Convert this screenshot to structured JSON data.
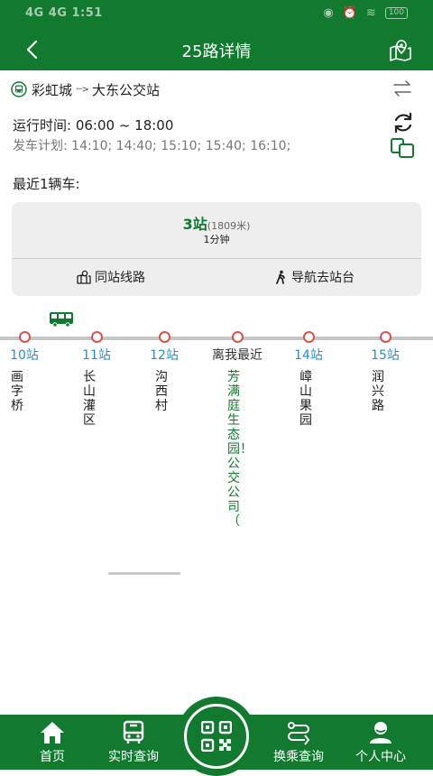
{
  "status_bar": {
    "time": "1:51",
    "network": "4G 4G",
    "battery": "100"
  },
  "header": {
    "title": "25路详情"
  },
  "route": {
    "from": "彩虹城",
    "arrow": "···>",
    "to": "大东公交站"
  },
  "schedule": {
    "operating_hours": "运行时间: 06:00 ~ 18:00",
    "departure_plan": "发车计划: 14:10; 14:40; 15:10; 15:40; 16:10;"
  },
  "recent": {
    "label": "最近1辆车:"
  },
  "bus_card": {
    "stops_away": "3站",
    "distance": "(1809米)",
    "eta": "1分钟",
    "same_station_lines": "同站线路",
    "navigate_to_stop": "导航去站台"
  },
  "stations": [
    {
      "label": "10站",
      "name": "画字桥"
    },
    {
      "label": "11站",
      "name": "长山灌区"
    },
    {
      "label": "12站",
      "name": "沟西村"
    },
    {
      "label": "离我最近",
      "name": "芳满庭生态园！公交公司（"
    },
    {
      "label": "14站",
      "name": "嶂山果园"
    },
    {
      "label": "15站",
      "name": "润兴路"
    }
  ],
  "tabs": {
    "home": "首页",
    "realtime": "实时查询",
    "transfer": "换乘查询",
    "profile": "个人中心"
  },
  "colors": {
    "brand": "#117a2f",
    "stop_link": "#2a8ec6",
    "stop_dot": "#d9534f"
  }
}
